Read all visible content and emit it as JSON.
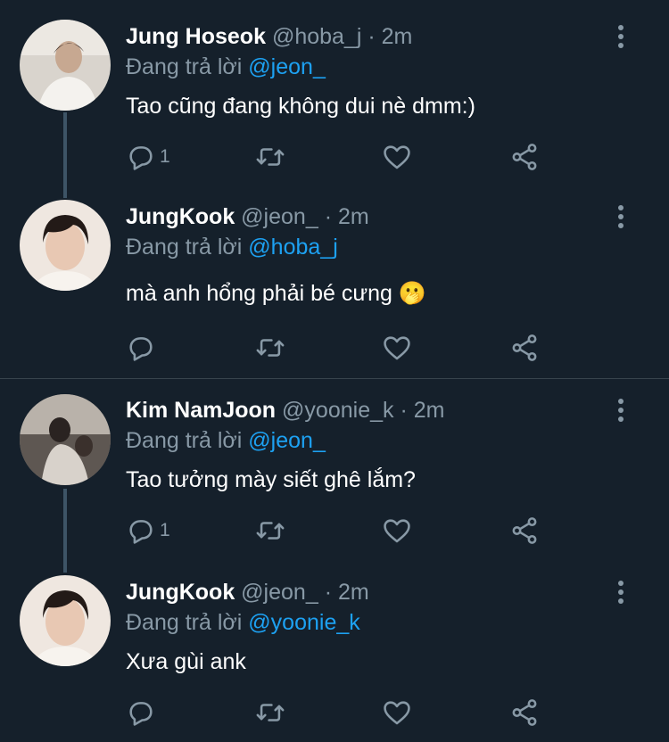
{
  "colors": {
    "background": "#15202b",
    "text": "#ffffff",
    "muted": "#8899a6",
    "mention": "#1da1f2",
    "thread_line": "#3d5466",
    "divider": "#38444d"
  },
  "tweets": [
    {
      "name": "Jung Hoseok",
      "handle": "@hoba_j",
      "separator": "·",
      "time": "2m",
      "replying_label": "Đang trả lời",
      "replying_to": "@jeon_",
      "text": "Tao cũng đang không dui nè dmm:)",
      "reply_count": "1",
      "avatar_icon": "profile-photo"
    },
    {
      "name": "JungKook",
      "handle": "@jeon_",
      "separator": "·",
      "time": "2m",
      "replying_label": "Đang trả lời",
      "replying_to": "@hoba_j",
      "text": "mà anh hổng phải bé cưng 🫢",
      "reply_count": "",
      "avatar_icon": "profile-photo"
    },
    {
      "name": "Kim NamJoon",
      "handle": "@yoonie_k",
      "separator": "·",
      "time": "2m",
      "replying_label": "Đang trả lời",
      "replying_to": "@jeon_",
      "text": "Tao tưởng mày siết ghê lắm?",
      "reply_count": "1",
      "avatar_icon": "profile-photo"
    },
    {
      "name": "JungKook",
      "handle": "@jeon_",
      "separator": "·",
      "time": "2m",
      "replying_label": "Đang trả lời",
      "replying_to": "@yoonie_k",
      "text": "Xưa gùi ank",
      "reply_count": "",
      "avatar_icon": "profile-photo"
    }
  ],
  "icons": {
    "reply": "reply-icon",
    "retweet": "retweet-icon",
    "like": "heart-icon",
    "share": "share-icon",
    "more": "more-vertical-icon"
  }
}
